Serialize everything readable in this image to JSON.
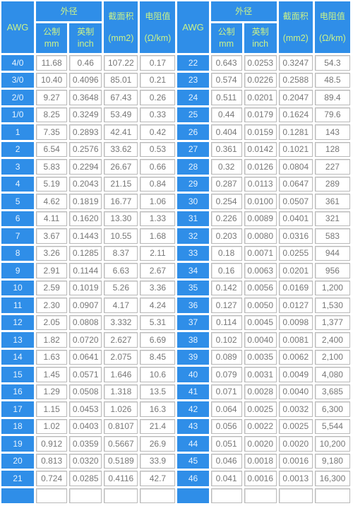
{
  "headers": {
    "awg": "AWG",
    "outer_diameter": "外径",
    "metric_cn": "公制",
    "metric_unit": "mm",
    "imperial_cn": "英制",
    "imperial_unit": "inch",
    "area_cn": "截面积",
    "area_unit": "(mm2)",
    "resistance_cn": "电阻值",
    "resistance_unit": "(Ω/km)"
  },
  "colors": {
    "header_bg": "#2f8ee8",
    "header_text": "#c9f28a",
    "awg_text": "#e6f3ff",
    "cell_text": "#777777",
    "cell_border": "#b9b9b9"
  },
  "left_rows": [
    {
      "awg": "4/0",
      "mm": "11.68",
      "inch": "0.46",
      "area": "107.22",
      "res": "0.17"
    },
    {
      "awg": "3/0",
      "mm": "10.40",
      "inch": "0.4096",
      "area": "85.01",
      "res": "0.21"
    },
    {
      "awg": "2/0",
      "mm": "9.27",
      "inch": "0.3648",
      "area": "67.43",
      "res": "0.26"
    },
    {
      "awg": "1/0",
      "mm": "8.25",
      "inch": "0.3249",
      "area": "53.49",
      "res": "0.33"
    },
    {
      "awg": "1",
      "mm": "7.35",
      "inch": "0.2893",
      "area": "42.41",
      "res": "0.42"
    },
    {
      "awg": "2",
      "mm": "6.54",
      "inch": "0.2576",
      "area": "33.62",
      "res": "0.53"
    },
    {
      "awg": "3",
      "mm": "5.83",
      "inch": "0.2294",
      "area": "26.67",
      "res": "0.66"
    },
    {
      "awg": "4",
      "mm": "5.19",
      "inch": "0.2043",
      "area": "21.15",
      "res": "0.84"
    },
    {
      "awg": "5",
      "mm": "4.62",
      "inch": "0.1819",
      "area": "16.77",
      "res": "1.06"
    },
    {
      "awg": "6",
      "mm": "4.11",
      "inch": "0.1620",
      "area": "13.30",
      "res": "1.33"
    },
    {
      "awg": "7",
      "mm": "3.67",
      "inch": "0.1443",
      "area": "10.55",
      "res": "1.68"
    },
    {
      "awg": "8",
      "mm": "3.26",
      "inch": "0.1285",
      "area": "8.37",
      "res": "2.11"
    },
    {
      "awg": "9",
      "mm": "2.91",
      "inch": "0.1144",
      "area": "6.63",
      "res": "2.67"
    },
    {
      "awg": "10",
      "mm": "2.59",
      "inch": "0.1019",
      "area": "5.26",
      "res": "3.36"
    },
    {
      "awg": "11",
      "mm": "2.30",
      "inch": "0.0907",
      "area": "4.17",
      "res": "4.24"
    },
    {
      "awg": "12",
      "mm": "2.05",
      "inch": "0.0808",
      "area": "3.332",
      "res": "5.31"
    },
    {
      "awg": "13",
      "mm": "1.82",
      "inch": "0.0720",
      "area": "2.627",
      "res": "6.69"
    },
    {
      "awg": "14",
      "mm": "1.63",
      "inch": "0.0641",
      "area": "2.075",
      "res": "8.45"
    },
    {
      "awg": "15",
      "mm": "1.45",
      "inch": "0.0571",
      "area": "1.646",
      "res": "10.6"
    },
    {
      "awg": "16",
      "mm": "1.29",
      "inch": "0.0508",
      "area": "1.318",
      "res": "13.5"
    },
    {
      "awg": "17",
      "mm": "1.15",
      "inch": "0.0453",
      "area": "1.026",
      "res": "16.3"
    },
    {
      "awg": "18",
      "mm": "1.02",
      "inch": "0.0403",
      "area": "0.8107",
      "res": "21.4"
    },
    {
      "awg": "19",
      "mm": "0.912",
      "inch": "0.0359",
      "area": "0.5667",
      "res": "26.9"
    },
    {
      "awg": "20",
      "mm": "0.813",
      "inch": "0.0320",
      "area": "0.5189",
      "res": "33.9"
    },
    {
      "awg": "21",
      "mm": "0.724",
      "inch": "0.0285",
      "area": "0.4116",
      "res": "42.7"
    },
    {
      "awg": "",
      "mm": "",
      "inch": "",
      "area": "",
      "res": ""
    }
  ],
  "right_rows": [
    {
      "awg": "22",
      "mm": "0.643",
      "inch": "0.0253",
      "area": "0.3247",
      "res": "54.3"
    },
    {
      "awg": "23",
      "mm": "0.574",
      "inch": "0.0226",
      "area": "0.2588",
      "res": "48.5"
    },
    {
      "awg": "24",
      "mm": "0.511",
      "inch": "0.0201",
      "area": "0.2047",
      "res": "89.4"
    },
    {
      "awg": "25",
      "mm": "0.44",
      "inch": "0.0179",
      "area": "0.1624",
      "res": "79.6"
    },
    {
      "awg": "26",
      "mm": "0.404",
      "inch": "0.0159",
      "area": "0.1281",
      "res": "143"
    },
    {
      "awg": "27",
      "mm": "0.361",
      "inch": "0.0142",
      "area": "0.1021",
      "res": "128"
    },
    {
      "awg": "28",
      "mm": "0.32",
      "inch": "0.0126",
      "area": "0.0804",
      "res": "227"
    },
    {
      "awg": "29",
      "mm": "0.287",
      "inch": "0.0113",
      "area": "0.0647",
      "res": "289"
    },
    {
      "awg": "30",
      "mm": "0.254",
      "inch": "0.0100",
      "area": "0.0507",
      "res": "361"
    },
    {
      "awg": "31",
      "mm": "0.226",
      "inch": "0.0089",
      "area": "0.0401",
      "res": "321"
    },
    {
      "awg": "32",
      "mm": "0.203",
      "inch": "0.0080",
      "area": "0.0316",
      "res": "583"
    },
    {
      "awg": "33",
      "mm": "0.18",
      "inch": "0.0071",
      "area": "0.0255",
      "res": "944"
    },
    {
      "awg": "34",
      "mm": "0.16",
      "inch": "0.0063",
      "area": "0.0201",
      "res": "956"
    },
    {
      "awg": "35",
      "mm": "0.142",
      "inch": "0.0056",
      "area": "0.0169",
      "res": "1,200"
    },
    {
      "awg": "36",
      "mm": "0.127",
      "inch": "0.0050",
      "area": "0.0127",
      "res": "1,530"
    },
    {
      "awg": "37",
      "mm": "0.114",
      "inch": "0.0045",
      "area": "0.0098",
      "res": "1,377"
    },
    {
      "awg": "38",
      "mm": "0.102",
      "inch": "0.0040",
      "area": "0.0081",
      "res": "2,400"
    },
    {
      "awg": "39",
      "mm": "0.089",
      "inch": "0.0035",
      "area": "0.0062",
      "res": "2,100"
    },
    {
      "awg": "40",
      "mm": "0.079",
      "inch": "0.0031",
      "area": "0.0049",
      "res": "4,080"
    },
    {
      "awg": "41",
      "mm": "0.071",
      "inch": "0.0028",
      "area": "0.0040",
      "res": "3,685"
    },
    {
      "awg": "42",
      "mm": "0.064",
      "inch": "0.0025",
      "area": "0.0032",
      "res": "6,300"
    },
    {
      "awg": "43",
      "mm": "0.056",
      "inch": "0.0022",
      "area": "0.0025",
      "res": "5,544"
    },
    {
      "awg": "44",
      "mm": "0.051",
      "inch": "0.0020",
      "area": "0.0020",
      "res": "10,200"
    },
    {
      "awg": "45",
      "mm": "0.046",
      "inch": "0.0018",
      "area": "0.0016",
      "res": "9,180"
    },
    {
      "awg": "46",
      "mm": "0.041",
      "inch": "0.0016",
      "area": "0.0013",
      "res": "16,300"
    },
    {
      "awg": "",
      "mm": "",
      "inch": "",
      "area": "",
      "res": ""
    }
  ]
}
